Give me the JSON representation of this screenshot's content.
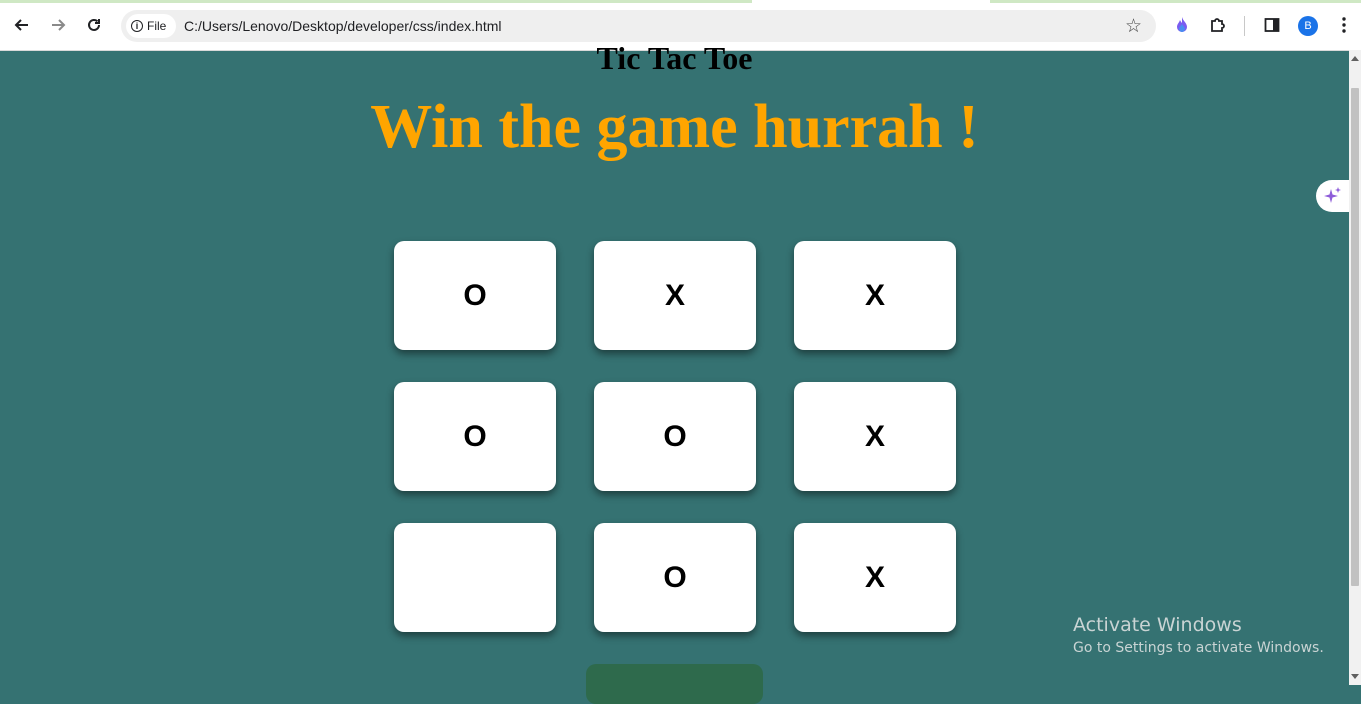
{
  "browser": {
    "site_chip_label": "File",
    "url": "C:/Users/Lenovo/Desktop/developer/css/index.html",
    "profile_initial": "B"
  },
  "page": {
    "title": "Tic Tac Toe",
    "win_message": "Win the game hurrah !",
    "board": {
      "cells": [
        "O",
        "X",
        "X",
        "O",
        "O",
        "X",
        "",
        "O",
        "X"
      ]
    },
    "reset_button_label": ""
  },
  "watermark": {
    "title": "Activate Windows",
    "subtitle": "Go to Settings to activate Windows."
  },
  "colors": {
    "background": "#357272",
    "win_message": "#ffa500",
    "cell": "#ffffff",
    "reset_button": "#2e6a4c"
  }
}
